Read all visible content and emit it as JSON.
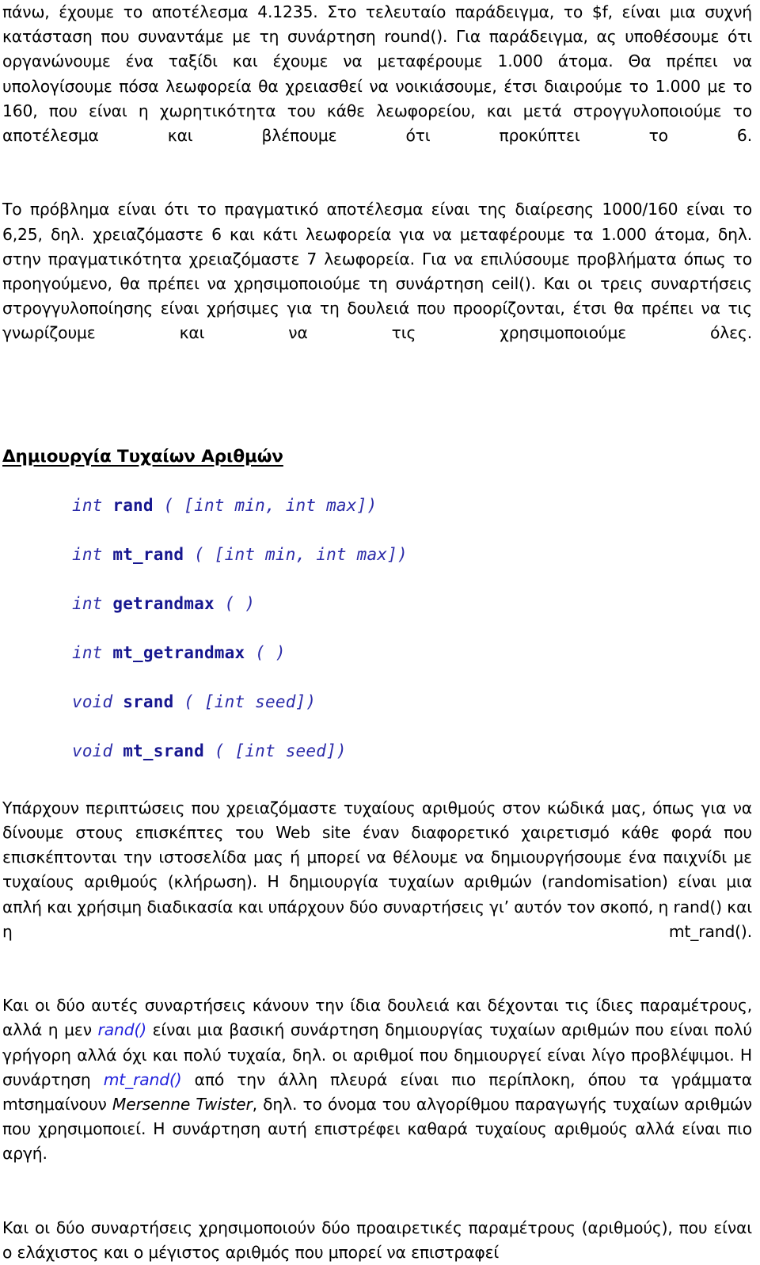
{
  "document": {
    "language": "el",
    "paragraphs_before_heading": [
      {
        "id": "p1",
        "text": "πάνω, έχουμε το αποτέλεσμα 4.1235. Στο τελευταίο παράδειγμα, το $f, είναι μια συχνή κατάσταση που συναντάμε με τη συνάρτηση round(). Για παράδειγμα, ας υποθέσουμε ότι οργανώνουμε ένα ταξίδι και έχουμε να μεταφέρουμε 1.000 άτομα. Θα πρέπει να υπολογίσουμε πόσα λεωφορεία θα χρειασθεί να νοικιάσουμε, έτσι διαιρούμε το 1.000 με το 160, που είναι η χωρητικότητα του κάθε λεωφορείου, και μετά στρογγυλοποιούμε το αποτέλεσμα και βλέπουμε ότι προκύπτει το 6."
      },
      {
        "id": "p2",
        "text": "Το πρόβλημα είναι ότι το πραγματικό αποτέλεσμα είναι της διαίρεσης 1000/160 είναι το 6,25, δηλ. χρειαζόμαστε 6 και κάτι λεωφορεία για να μεταφέρουμε τα 1.000 άτομα, δηλ. στην πραγματικότητα χρειαζόμαστε 7 λεωφορεία. Για να επιλύσουμε προβλήματα όπως το προηγούμενο, θα πρέπει να χρησιμοποιούμε τη συνάρτηση ceil(). Και οι τρεις συναρτήσεις στρογγυλοποίησης είναι χρήσιμες για τη δουλειά που προορίζονται, έτσι θα πρέπει να τις γνωρίζουμε και να τις χρησιμοποιούμε όλες."
      }
    ],
    "heading": "Δημιουργία Τυχαίων Αριθμών",
    "code_block": [
      {
        "id": "sig-rand",
        "return_type": "int",
        "name": "rand",
        "signature": "( [int min, int max])"
      },
      {
        "id": "sig-mt-rand",
        "return_type": "int",
        "name": "mt_rand",
        "signature": "( [int min, int max])"
      },
      {
        "id": "sig-getrandmax",
        "return_type": "int",
        "name": "getrandmax",
        "signature": "( )"
      },
      {
        "id": "sig-mt-getrandmax",
        "return_type": "int",
        "name": "mt_getrandmax",
        "signature": "( )"
      },
      {
        "id": "sig-srand",
        "return_type": "void",
        "name": "srand",
        "signature": "( [int seed])"
      },
      {
        "id": "sig-mt-srand",
        "return_type": "void",
        "name": "mt_srand",
        "signature": "( [int seed])"
      }
    ],
    "paragraphs_after_code": {
      "p3": {
        "text": "Υπάρχουν περιπτώσεις που χρειαζόμαστε τυχαίους αριθμούς στον κώδικά μας, όπως για να δίνουμε στους επισκέπτες του Web site έναν διαφορετικό χαιρετισμό κάθε φορά που επισκέπτονται την ιστοσελίδα μας ή μπορεί να θέλουμε να δημιουργήσουμε ένα παιχνίδι με τυχαίους αριθμούς (κλήρωση). Η δημιουργία τυχαίων αριθμών (randomisation) είναι μια απλή και χρήσιμη διαδικασία και υπάρχουν δύο συναρτήσεις γι’ αυτόν τον σκοπό, η rand() και η mt_rand()."
      },
      "p4": {
        "seg1": "Και οι δύο αυτές συναρτήσεις κάνουν την ίδια δουλειά και δέχονται τις ίδιες παραμέτρους, αλλά η μεν ",
        "link1": "rand()",
        "seg2": " είναι μια βασική συνάρτηση δημιουργίας τυχαίων αριθμών που είναι πολύ γρήγορη αλλά όχι και πολύ τυχαία, δηλ. οι αριθμοί που δημιουργεί είναι λίγο προβλέψιμοι. Η συνάρτηση ",
        "link2": "mt_rand()",
        "seg3": " από την άλλη πλευρά είναι πιο περίπλοκη, όπου τα γράμματα mtσημαίνουν ",
        "italic1": "Mersenne Twister",
        "seg4": ", δηλ. το όνομα του αλγορίθμου παραγωγής τυχαίων αριθμών που χρησιμοποιεί. Η συνάρτηση αυτή επιστρέφει καθαρά τυχαίους αριθμούς αλλά είναι πιο αργή."
      },
      "p5": {
        "text": "Και οι δύο συναρτήσεις χρησιμοποιούν δύο προαιρετικές παραμέτρους (αριθμούς), που είναι ο ελάχιστος και ο μέγιστος αριθμός που μπορεί να επιστραφεί"
      }
    },
    "colors": {
      "text": "#000000",
      "code_blue": "#1f1f9c",
      "inline_link_blue": "#2222dd",
      "background": "#ffffff"
    }
  }
}
